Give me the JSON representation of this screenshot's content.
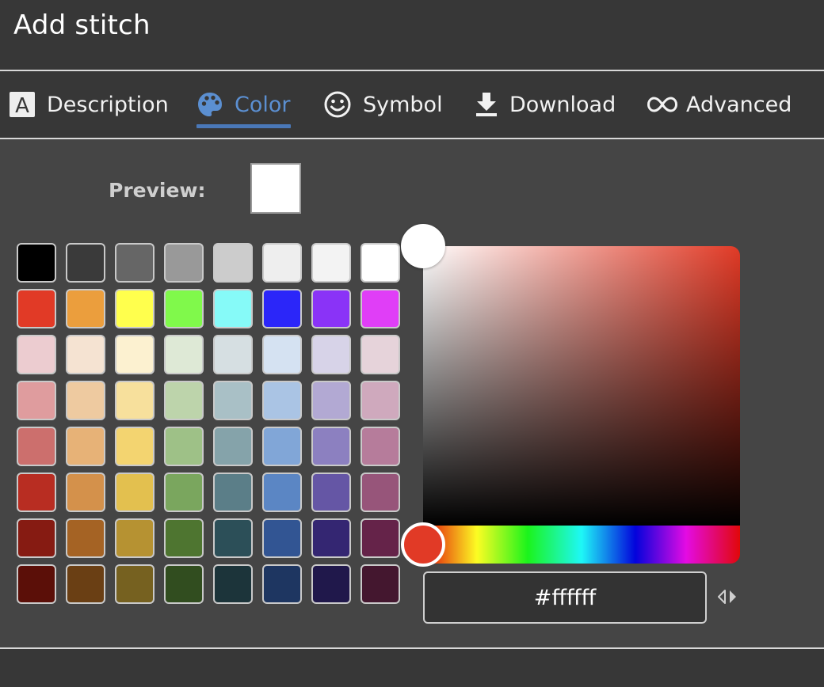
{
  "header": {
    "title": "Add stitch"
  },
  "tabs": [
    {
      "label": "Description",
      "icon": "text-a-icon"
    },
    {
      "label": "Color",
      "icon": "palette-icon",
      "active": true
    },
    {
      "label": "Symbol",
      "icon": "smiley-icon"
    },
    {
      "label": "Download",
      "icon": "download-icon"
    },
    {
      "label": "Advanced",
      "icon": "infinity-icon"
    }
  ],
  "preview": {
    "label": "Preview:",
    "color": "#ffffff"
  },
  "palette": [
    [
      "#000000",
      "#3a3a3a",
      "#666666",
      "#999999",
      "#cccccc",
      "#eeeeee",
      "#f3f3f3",
      "#ffffff"
    ],
    [
      "#e13a26",
      "#eb9e3d",
      "#ffff4d",
      "#80f94b",
      "#86faf8",
      "#2b26f9",
      "#8a33f7",
      "#e03ef7"
    ],
    [
      "#ecccd0",
      "#f5e3d2",
      "#fcf1d0",
      "#dee9d6",
      "#d6dfe2",
      "#d5e2f2",
      "#d7d3e8",
      "#e6d3da"
    ],
    [
      "#df9c9e",
      "#eecaa0",
      "#f7e09c",
      "#bdd4ab",
      "#a9c0c6",
      "#aac4e4",
      "#b2a9d3",
      "#cfa9bd"
    ],
    [
      "#cc6f6d",
      "#e7b277",
      "#f3d470",
      "#9ec187",
      "#85a3aa",
      "#81a6d7",
      "#8c80c0",
      "#b67c9b"
    ],
    [
      "#b82d22",
      "#d4914b",
      "#e3c04f",
      "#7aa65e",
      "#5b7e88",
      "#5b86c4",
      "#6556a5",
      "#97557a"
    ],
    [
      "#861b12",
      "#a56324",
      "#b69232",
      "#4e7530",
      "#2c4f58",
      "#325593",
      "#342672",
      "#652349"
    ],
    [
      "#5b0f08",
      "#6a3f14",
      "#766120",
      "#314d1f",
      "#1c343a",
      "#1e3661",
      "#20184b",
      "#44172f"
    ]
  ],
  "picker": {
    "hue_color": "#e13a26",
    "value": "#ffffff",
    "saturation": 0,
    "brightness": 1,
    "hue_fraction": 0
  },
  "footer": {}
}
